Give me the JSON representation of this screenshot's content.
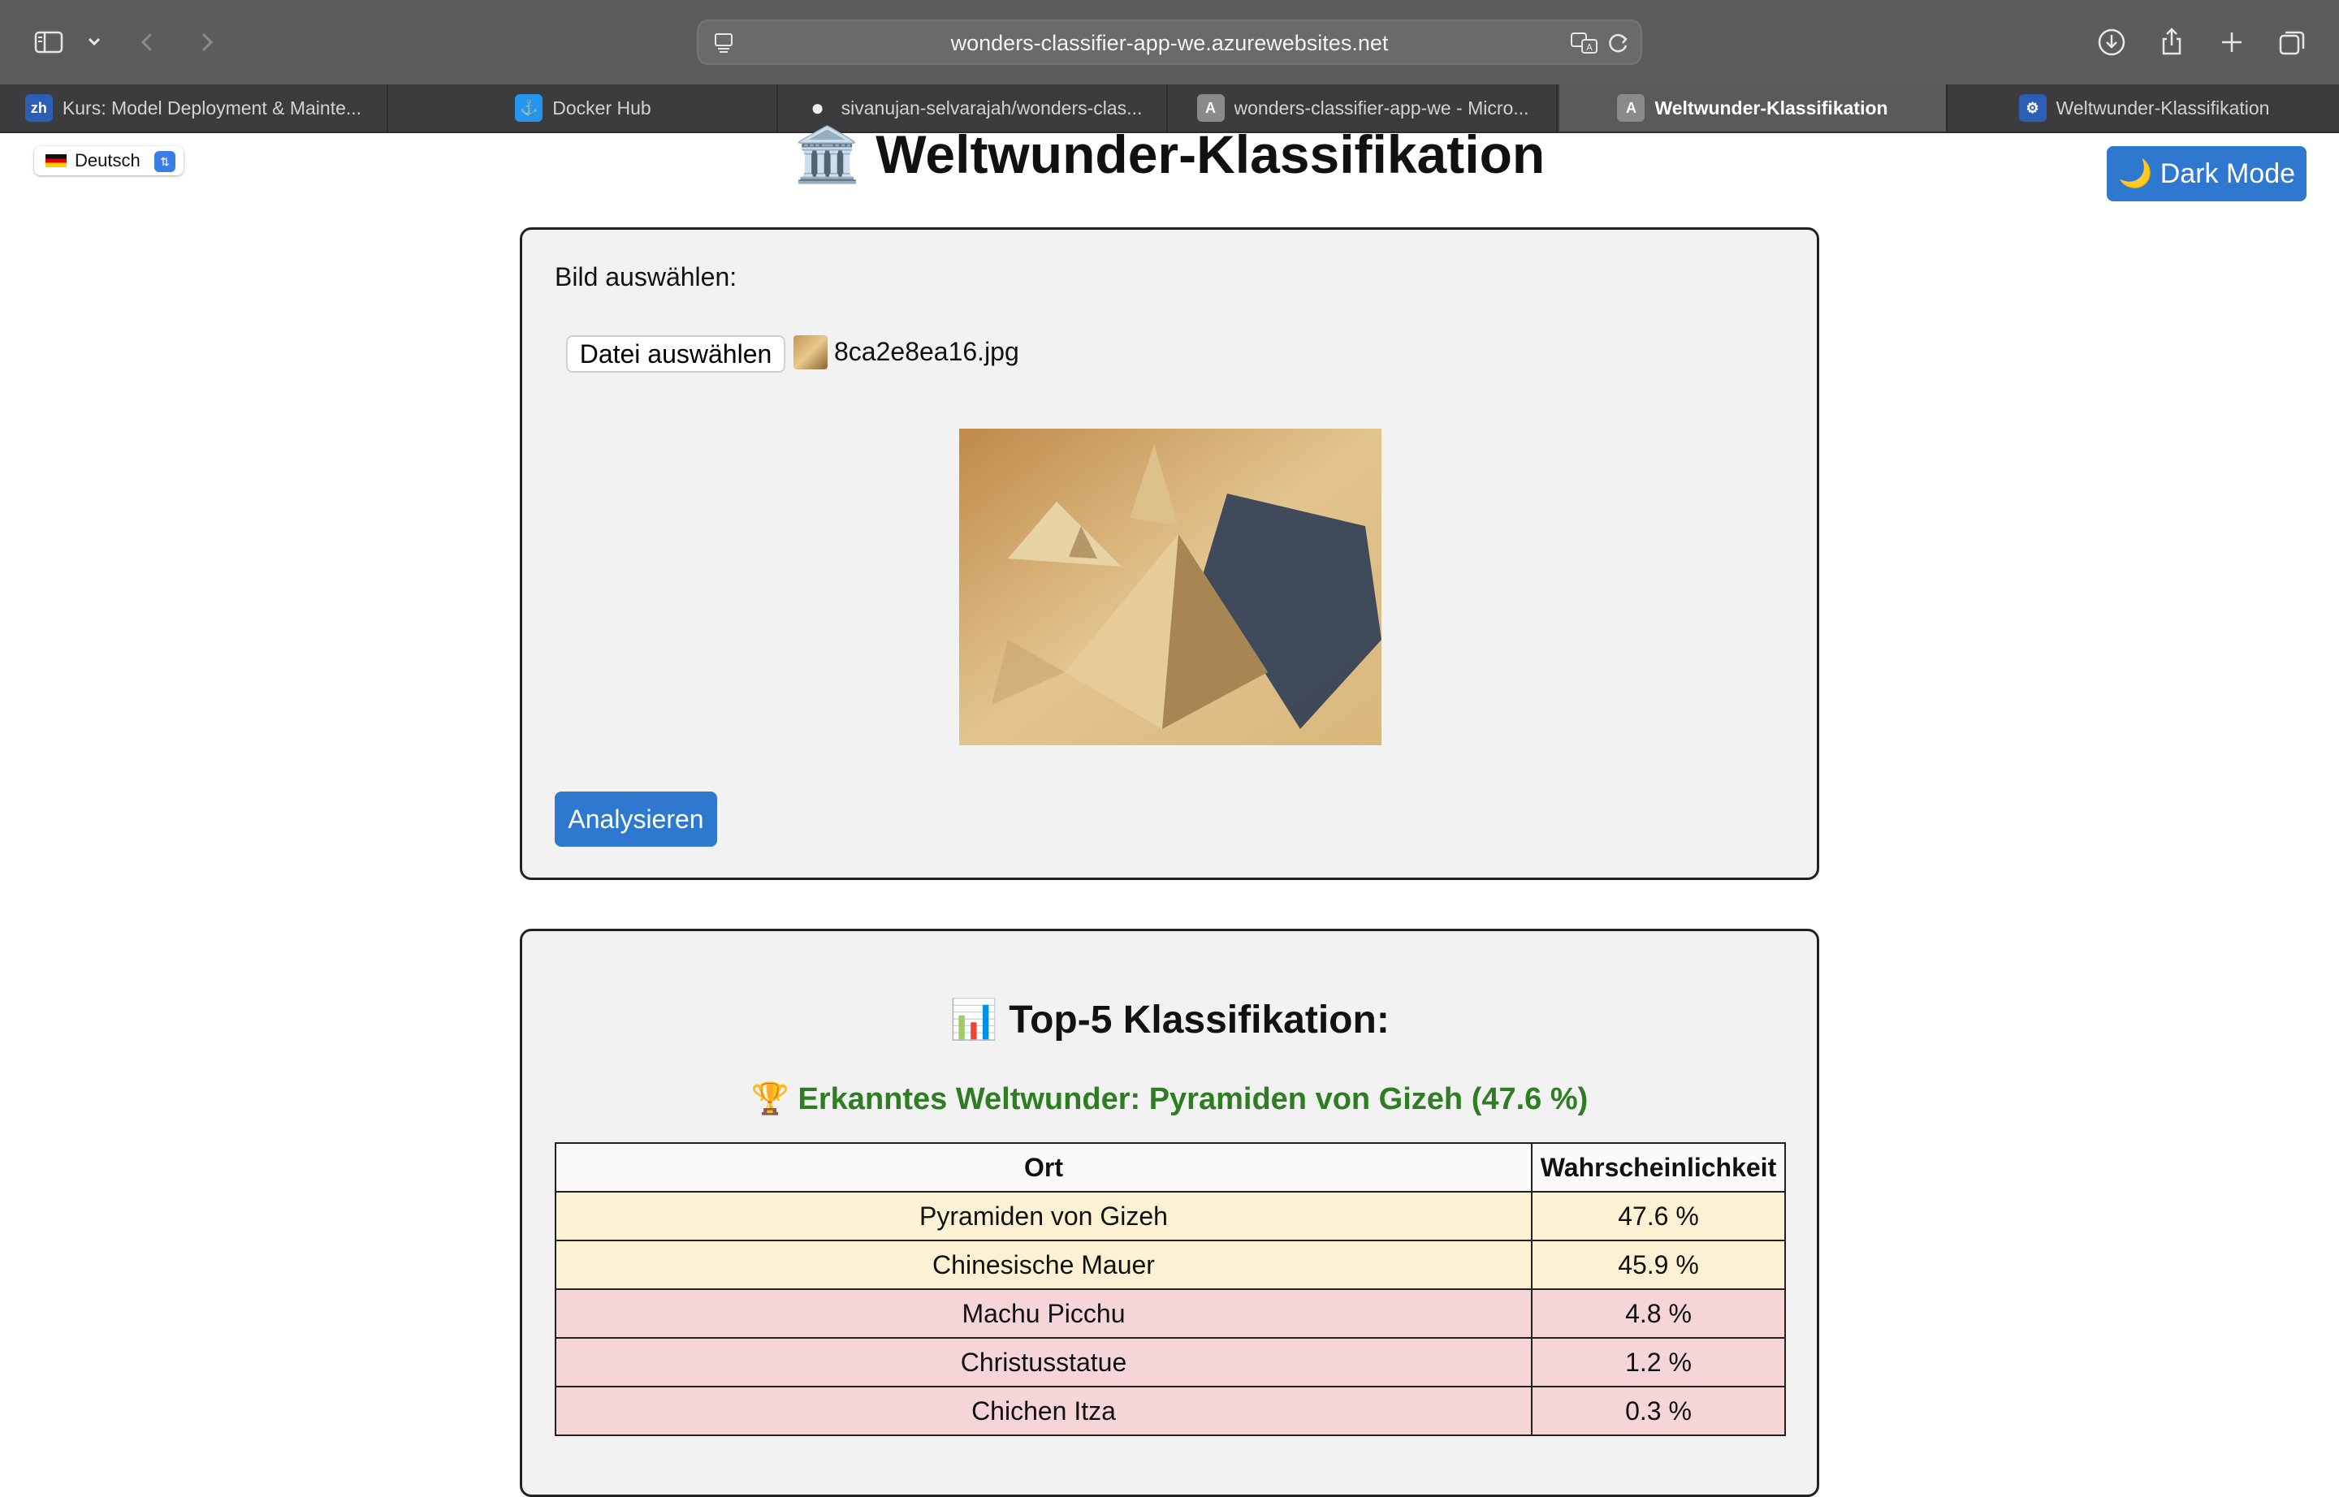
{
  "browser": {
    "address": "wonders-classifier-app-we.azurewebsites.net",
    "tabs": [
      {
        "label": "Kurs: Model Deployment & Mainte...",
        "favicon_text": "zh",
        "favicon_color": "#2a5fb5",
        "active": false
      },
      {
        "label": "Docker Hub",
        "favicon_text": "⚓",
        "favicon_color": "#2496ed",
        "active": false
      },
      {
        "label": "sivanujan-selvarajah/wonders-clas...",
        "favicon_text": "●",
        "favicon_color": "#f0f0f0",
        "active": false
      },
      {
        "label": "wonders-classifier-app-we - Micro...",
        "favicon_text": "A",
        "favicon_color": "#8a8a8a",
        "active": false
      },
      {
        "label": "Weltwunder-Klassifikation",
        "favicon_text": "A",
        "favicon_color": "#8a8a8a",
        "active": true
      },
      {
        "label": "Weltwunder-Klassifikation",
        "favicon_text": "⚙",
        "favicon_color": "#2a5fb5",
        "active": false
      }
    ]
  },
  "page": {
    "language": "Deutsch",
    "title": "🏛️ Weltwunder-Klassifikation",
    "dark_mode_label": "🌙 Dark Mode",
    "upload_label": "Bild auswählen:",
    "file_button_label": "Datei auswählen",
    "file_name": "8ca2e8ea16.jpg",
    "analyze_label": "Analysieren",
    "results_title": "📊 Top-5 Klassifikation:",
    "recognized": "🏆 Erkanntes Weltwunder: Pyramiden von Gizeh (47.6 %)",
    "table_headers": [
      "Ort",
      "Wahrscheinlichkeit"
    ],
    "rows": [
      {
        "place": "Pyramiden von Gizeh",
        "prob": "47.6 %"
      },
      {
        "place": "Chinesische Mauer",
        "prob": "45.9 %"
      },
      {
        "place": "Machu Picchu",
        "prob": "4.8 %"
      },
      {
        "place": "Christusstatue",
        "prob": "1.2 %"
      },
      {
        "place": "Chichen Itza",
        "prob": "0.3 %"
      }
    ]
  },
  "colors": {
    "accent": "#2f78d0",
    "success": "#2e7d23",
    "high_row": "#fcf2d3",
    "low_row": "#f5d5d8"
  }
}
